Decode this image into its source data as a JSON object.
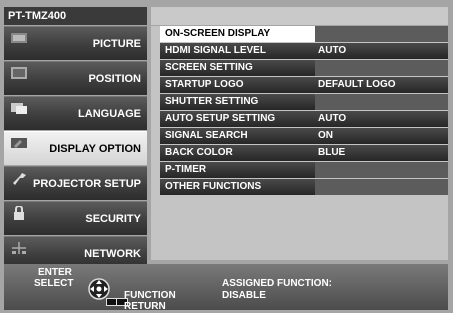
{
  "model": "PT-TMZ400",
  "nav": [
    {
      "label": "PICTURE",
      "icon": "picture-icon",
      "active": false
    },
    {
      "label": "POSITION",
      "icon": "position-icon",
      "active": false
    },
    {
      "label": "LANGUAGE",
      "icon": "language-icon",
      "active": false
    },
    {
      "label": "DISPLAY OPTION",
      "icon": "display-option-icon",
      "active": true
    },
    {
      "label": "PROJECTOR SETUP",
      "icon": "wrench-icon",
      "active": false
    },
    {
      "label": "SECURITY",
      "icon": "lock-icon",
      "active": false
    },
    {
      "label": "NETWORK",
      "icon": "network-icon",
      "active": false
    }
  ],
  "menu": [
    {
      "name": "ON-SCREEN DISPLAY",
      "value": "",
      "selected": true
    },
    {
      "name": "HDMI SIGNAL LEVEL",
      "value": "AUTO",
      "selected": false
    },
    {
      "name": "SCREEN SETTING",
      "value": "",
      "selected": false
    },
    {
      "name": "STARTUP LOGO",
      "value": "DEFAULT LOGO",
      "selected": false
    },
    {
      "name": "SHUTTER SETTING",
      "value": "",
      "selected": false
    },
    {
      "name": "AUTO SETUP SETTING",
      "value": "AUTO",
      "selected": false
    },
    {
      "name": "SIGNAL SEARCH",
      "value": "ON",
      "selected": false
    },
    {
      "name": "BACK COLOR",
      "value": "BLUE",
      "selected": false
    },
    {
      "name": "P-TIMER",
      "value": "",
      "selected": false
    },
    {
      "name": "OTHER FUNCTIONS",
      "value": "",
      "selected": false
    }
  ],
  "footer": {
    "enter": "ENTER",
    "select": "SELECT",
    "function": "FUNCTION",
    "return": "RETURN",
    "assigned_label": "ASSIGNED FUNCTION:",
    "assigned_value": "DISABLE"
  },
  "colors": {
    "selected_row": "#ffffff",
    "row_bg": "#333333",
    "active_nav": "#e8e8e8"
  }
}
